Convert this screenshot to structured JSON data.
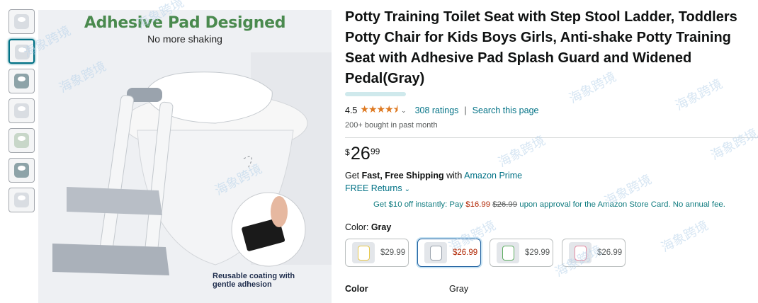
{
  "gallery": {
    "thumbnails": [
      {
        "name": "thumb-1"
      },
      {
        "name": "thumb-2",
        "active": true
      },
      {
        "name": "thumb-3"
      },
      {
        "name": "thumb-4"
      },
      {
        "name": "thumb-5"
      },
      {
        "name": "thumb-6"
      },
      {
        "name": "thumb-7"
      }
    ],
    "headline": "Adhesive Pad Designed",
    "subline": "No more shaking",
    "badge_line1": "Reusable coating with",
    "badge_line2": "gentle adhesion"
  },
  "product": {
    "title": "Potty Training Toilet Seat with Step Stool Ladder, Toddlers Potty Chair for Kids Boys Girls, Anti-shake Potty Training Seat with Adhesive Pad Splash Guard and Widened Pedal(Gray)",
    "rating": "4.5",
    "stars": "★★★★⯨",
    "ratings_count": "308 ratings",
    "search_link": "Search this page",
    "bought": "200+ bought in past month",
    "price": {
      "symbol": "$",
      "whole": "26",
      "fraction": "99"
    },
    "shipping_prefix": "Get ",
    "shipping_bold": "Fast, Free Shipping",
    "shipping_with": " with ",
    "shipping_link": "Amazon Prime",
    "returns": "FREE Returns",
    "card_offer": {
      "prefix": "Get $10 off instantly: Pay ",
      "new_price": "$16.99",
      "old_price": "$26.99",
      "suffix": " upon approval for the Amazon Store Card. No annual fee."
    },
    "color_label": "Color: ",
    "color_value": "Gray",
    "swatches": [
      {
        "price": "$29.99",
        "tint": "y"
      },
      {
        "price": "$26.99",
        "tint": "gray",
        "selected": true
      },
      {
        "price": "$29.99",
        "tint": "g"
      },
      {
        "price": "$26.99",
        "tint": "p"
      }
    ],
    "table": {
      "key": "Color",
      "value": "Gray"
    }
  },
  "watermark": "海象跨境",
  "colors": {
    "link": "#007185",
    "star": "#de7921",
    "price_red": "#b12704",
    "headline_green": "#4a8a4e"
  }
}
